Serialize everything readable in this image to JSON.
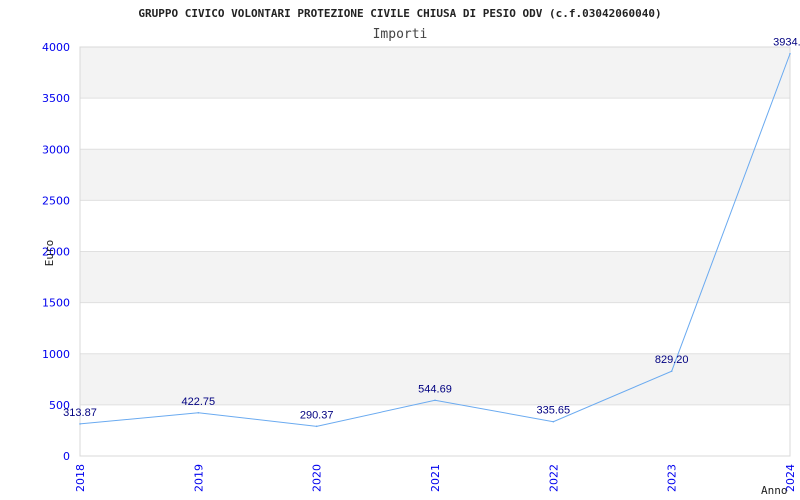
{
  "chart_data": {
    "type": "line",
    "title": "GRUPPO CIVICO VOLONTARI PROTEZIONE CIVILE CHIUSA DI PESIO ODV (c.f.03042060040)",
    "subtitle": "Importi",
    "xlabel": "Anno",
    "ylabel": "Euro",
    "categories": [
      "2018",
      "2019",
      "2020",
      "2021",
      "2022",
      "2023",
      "2024"
    ],
    "values": [
      313.87,
      422.75,
      290.37,
      544.69,
      335.65,
      829.2,
      3934.0
    ],
    "data_labels": [
      "313.87",
      "422.75",
      "290.37",
      "544.69",
      "335.65",
      "829.20",
      "3934.0"
    ],
    "ylim": [
      0,
      4000
    ],
    "yticks": [
      0,
      500,
      1000,
      1500,
      2000,
      2500,
      3000,
      3500,
      4000
    ],
    "grid": "alternating horizontal bands",
    "colors": {
      "line": "#6aaaf0",
      "band": "#f3f3f3",
      "tick": "#0000ee",
      "label": "#000080"
    }
  }
}
